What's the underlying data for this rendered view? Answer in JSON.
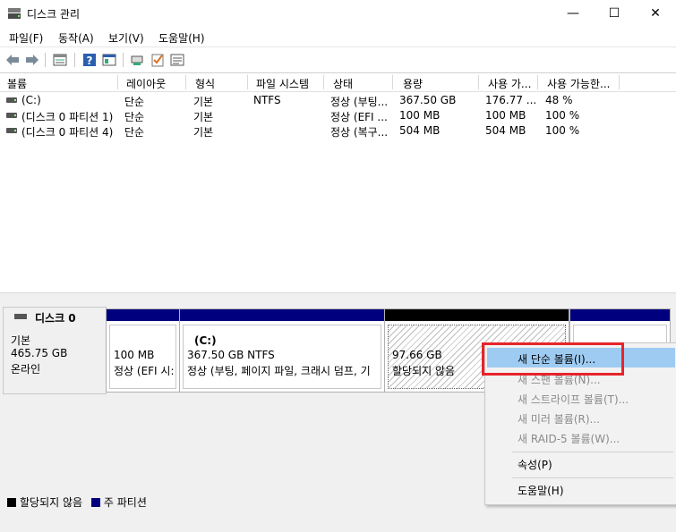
{
  "window": {
    "title": "디스크 관리",
    "minimize": "—",
    "maximize": "☐",
    "close": "✕"
  },
  "menu": [
    "파일(F)",
    "동작(A)",
    "보기(V)",
    "도움말(H)"
  ],
  "toolbar": {
    "icons": [
      "back-icon",
      "forward-icon",
      "list-view-icon",
      "help-icon",
      "properties-icon",
      "connect-icon",
      "check-icon",
      "settings-icon"
    ]
  },
  "volume_list": {
    "columns": [
      "볼륨",
      "레이아웃",
      "형식",
      "파일 시스템",
      "상태",
      "용량",
      "사용 가...",
      "사용 가능한..."
    ],
    "rows": [
      [
        "(C:)",
        "단순",
        "기본",
        "NTFS",
        "정상 (부팅...",
        "367.50 GB",
        "176.77 ...",
        "48 %"
      ],
      [
        "(디스크 0 파티션 1)",
        "단순",
        "기본",
        "",
        "정상 (EFI ...",
        "100 MB",
        "100 MB",
        "100 %"
      ],
      [
        "(디스크 0 파티션 4)",
        "단순",
        "기본",
        "",
        "정상 (복구...",
        "504 MB",
        "504 MB",
        "100 %"
      ]
    ]
  },
  "disk": {
    "name": "디스크 0",
    "type": "기본",
    "size": "465.75 GB",
    "status": "온라인",
    "partitions": [
      {
        "line1": "100 MB",
        "line2": "정상 (EFI 시:"
      },
      {
        "title": "(C:)",
        "line1": "367.50 GB NTFS",
        "line2": "정상 (부팅, 페이지 파일, 크래시 덤프, 기"
      },
      {
        "line1": "97.66 GB",
        "line2": "할당되지 않음"
      },
      {
        "line1": "",
        "line2": ""
      }
    ]
  },
  "legend": {
    "unallocated": "할당되지 않음",
    "primary": "주 파티션"
  },
  "context_menu": {
    "items": [
      {
        "label": "새 단순 볼륨(I)...",
        "enabled": true,
        "highlighted": true
      },
      {
        "label": "새 스팬 볼륨(N)...",
        "enabled": false
      },
      {
        "label": "새 스트라이프 볼륨(T)...",
        "enabled": false
      },
      {
        "label": "새 미러 볼륨(R)...",
        "enabled": false
      },
      {
        "label": "새 RAID-5 볼륨(W)...",
        "enabled": false
      },
      {
        "label": "속성(P)",
        "enabled": true
      },
      {
        "label": "도움말(H)",
        "enabled": true
      }
    ]
  },
  "colors": {
    "primary_partition": "#00007f",
    "unallocated": "#000000",
    "menu_highlight": "#9ecbf2",
    "annotation": "#e8242a"
  }
}
